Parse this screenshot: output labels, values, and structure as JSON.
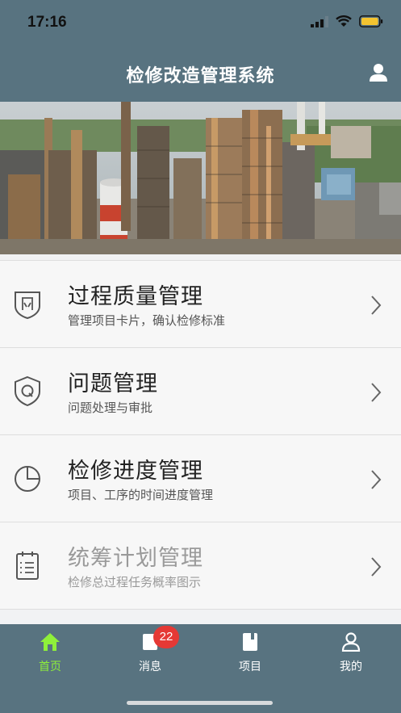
{
  "status_bar": {
    "time": "17:16"
  },
  "header": {
    "title": "检修改造管理系统"
  },
  "banner": {
    "image": "refinery-construction-photo"
  },
  "menu": {
    "items": [
      {
        "icon": "shield-quality-icon",
        "title": "过程质量管理",
        "subtitle": "管理项目卡片，确认检修标准"
      },
      {
        "icon": "shield-q-icon",
        "title": "问题管理",
        "subtitle": "问题处理与审批"
      },
      {
        "icon": "pie-chart-icon",
        "title": "检修进度管理",
        "subtitle": "项目、工序的时间进度管理"
      },
      {
        "icon": "clipboard-list-icon",
        "title": "统筹计划管理",
        "subtitle": "检修总过程任务概率图示"
      }
    ]
  },
  "tabbar": {
    "tabs": [
      {
        "label": "首页",
        "icon": "home-icon"
      },
      {
        "label": "消息",
        "icon": "message-icon",
        "badge": "22"
      },
      {
        "label": "项目",
        "icon": "book-icon"
      },
      {
        "label": "我的",
        "icon": "profile-icon"
      }
    ]
  },
  "colors": {
    "header": "#587380",
    "active_tab": "#8ff03a",
    "badge": "#e53935"
  }
}
